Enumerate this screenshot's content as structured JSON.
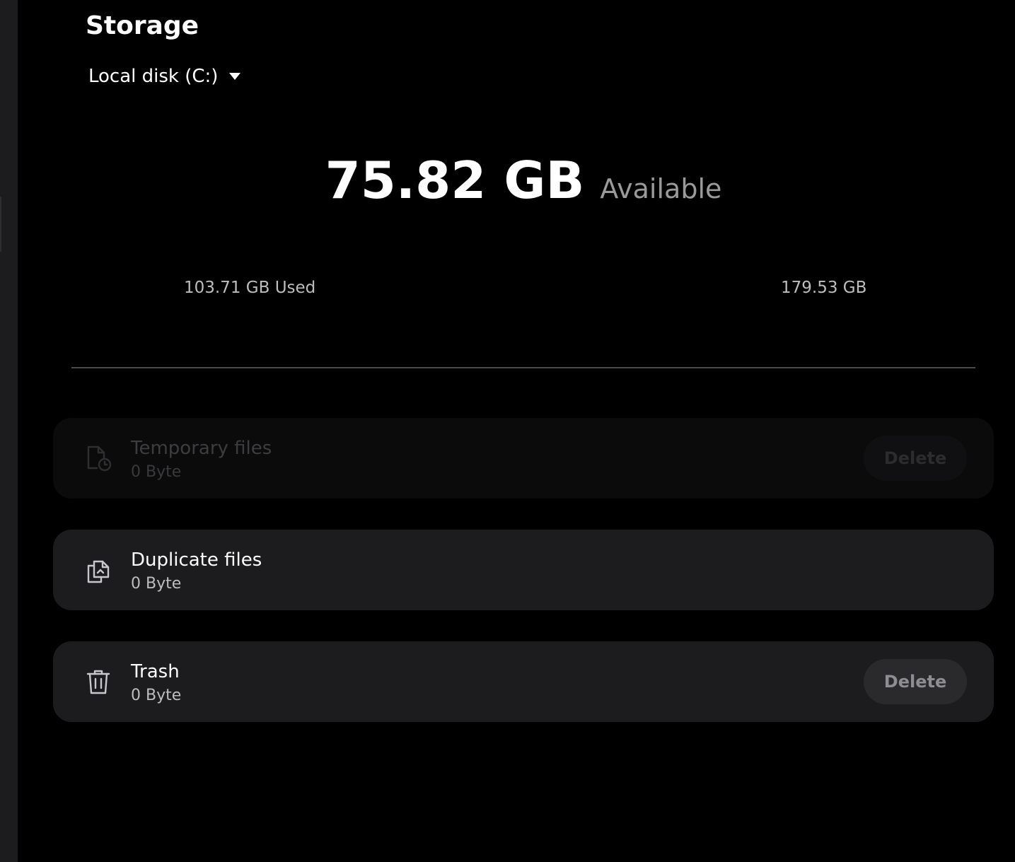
{
  "page": {
    "title": "Storage"
  },
  "disk_selector": {
    "selected": "Local disk (C:)"
  },
  "summary": {
    "available_value": "75.82 GB",
    "available_label": "Available",
    "used_label": "103.71 GB Used",
    "total_label": "179.53 GB"
  },
  "categories": [
    {
      "title": "Temporary files",
      "size": "0 Byte",
      "delete_label": "Delete",
      "enabled": false,
      "icon": "temporary-files-icon"
    },
    {
      "title": "Duplicate files",
      "size": "0 Byte",
      "enabled": true,
      "icon": "duplicate-files-icon"
    },
    {
      "title": "Trash",
      "size": "0 Byte",
      "delete_label": "Delete",
      "enabled": true,
      "icon": "trash-icon"
    }
  ],
  "colors": {
    "background": "#000000",
    "card": "#1c1c1f",
    "button": "#2a2a2d",
    "muted_text": "#bdbdbd"
  }
}
